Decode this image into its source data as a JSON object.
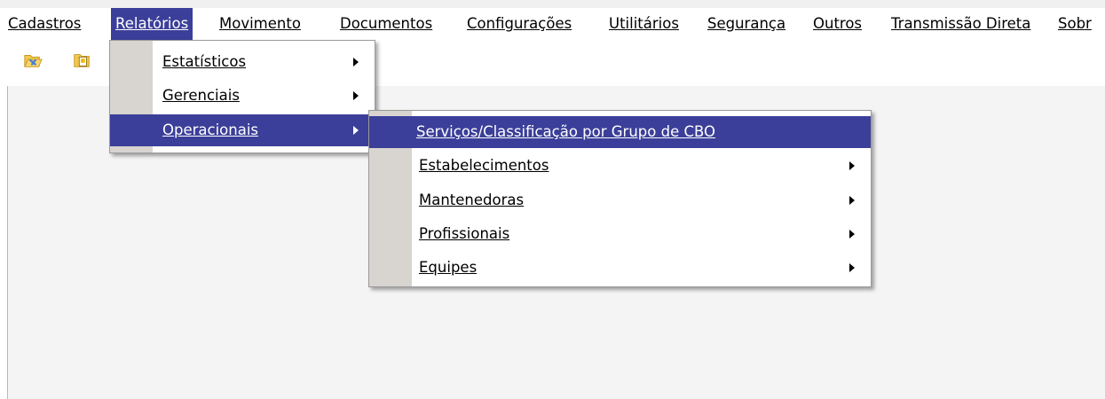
{
  "colors": {
    "highlight": "#3b3f99",
    "gutter": "#d8d4d0",
    "menubar_bg": "#ffffff",
    "client_bg": "#f4f4f4"
  },
  "menubar": {
    "items": [
      {
        "label": "Cadastros"
      },
      {
        "label": "Relatórios"
      },
      {
        "label": "Movimento"
      },
      {
        "label": "Documentos"
      },
      {
        "label": "Configurações"
      },
      {
        "label": "Utilitários"
      },
      {
        "label": "Segurança"
      },
      {
        "label": "Outros"
      },
      {
        "label": "Transmissão Direta"
      },
      {
        "label": "Sobr"
      }
    ]
  },
  "toolbar": {
    "icons": [
      {
        "icon": "folder-open-icon"
      },
      {
        "icon": "folder-document-icon"
      }
    ]
  },
  "relatorios_menu": {
    "items": [
      {
        "label": "Estatísticos",
        "submenu": true
      },
      {
        "label": "Gerenciais",
        "submenu": true
      },
      {
        "label": "Operacionais",
        "submenu": true,
        "selected": true
      }
    ]
  },
  "operacionais_menu": {
    "items": [
      {
        "label": "Serviços/Classificação por Grupo de CBO",
        "submenu": false,
        "selected": true
      },
      {
        "label": "Estabelecimentos",
        "submenu": true
      },
      {
        "label": "Mantenedoras",
        "submenu": true
      },
      {
        "label": "Profissionais",
        "submenu": true
      },
      {
        "label": "Equipes",
        "submenu": true
      }
    ]
  }
}
